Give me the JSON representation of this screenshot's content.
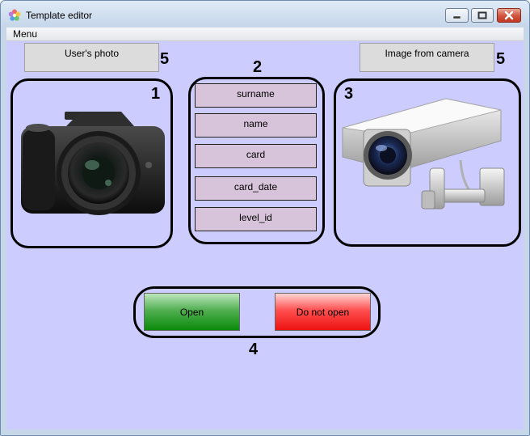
{
  "window": {
    "title": "Template editor",
    "icon": "flower-app-icon"
  },
  "menubar": {
    "items": [
      "Menu"
    ]
  },
  "labels": {
    "users_photo": "User's photo",
    "image_from_camera": "Image from camera"
  },
  "fields": [
    "surname",
    "name",
    "card",
    "card_date",
    "level_id"
  ],
  "buttons": {
    "open": "Open",
    "do_not_open": "Do not open"
  },
  "callouts": {
    "photo_frame": "1",
    "fields_frame": "2",
    "camera_frame": "3",
    "buttons_frame": "4",
    "photo_label": "5",
    "camera_label": "5"
  },
  "colors": {
    "content_background": "#ccccfe",
    "field_background": "#d8c4da",
    "open_button": "#0a8a0a",
    "do_not_open_button": "#ee1111"
  }
}
